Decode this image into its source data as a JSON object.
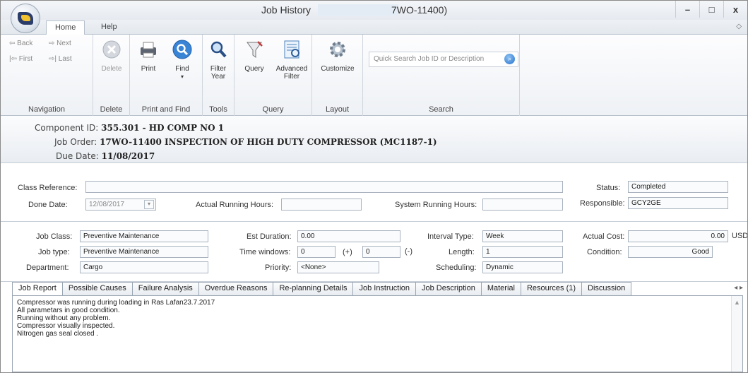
{
  "window": {
    "title": "Job History",
    "title_suffix": "7WO-11400)",
    "controls": [
      "–",
      "□",
      "x"
    ]
  },
  "ribbon_tabs": [
    "Home",
    "Help"
  ],
  "ribbon": {
    "navigation": {
      "back": "Back",
      "next": "Next",
      "first": "First",
      "last": "Last",
      "label": "Navigation"
    },
    "delete": {
      "button": "Delete",
      "label": "Delete"
    },
    "print_find": {
      "print": "Print",
      "find": "Find",
      "label": "Print and Find"
    },
    "tools": {
      "filter_year_1": "Filter",
      "filter_year_2": "Year",
      "label": "Tools"
    },
    "query": {
      "query": "Query",
      "advanced_1": "Advanced",
      "advanced_2": "Filter",
      "label": "Query"
    },
    "layout": {
      "customize": "Customize",
      "label": "Layout"
    },
    "search": {
      "placeholder": "Quick Search Job ID or Description",
      "label": "Search"
    }
  },
  "header": {
    "component_label": "Component ID:",
    "component_value": "355.301 - HD COMP NO 1",
    "job_order_label": "Job Order:",
    "job_order_value": "17WO-11400 INSPECTION OF HIGH DUTY COMPRESSOR (MC1187-1)",
    "due_date_label": "Due Date:",
    "due_date_value": "11/08/2017"
  },
  "section1": {
    "class_reference_label": "Class Reference:",
    "class_reference_value": "",
    "done_date_label": "Done Date:",
    "done_date_value": "12/08/2017",
    "actual_running_hours_label": "Actual Running Hours:",
    "actual_running_hours_value": "",
    "system_running_hours_label": "System Running Hours:",
    "system_running_hours_value": "",
    "status_label": "Status:",
    "status_value": "Completed",
    "responsible_label": "Responsible:",
    "responsible_value": "GCY2GE"
  },
  "section2": {
    "job_class_label": "Job Class:",
    "job_class_value": "Preventive Maintenance",
    "job_type_label": "Job type:",
    "job_type_value": "Preventive Maintenance",
    "department_label": "Department:",
    "department_value": "Cargo",
    "est_duration_label": "Est Duration:",
    "est_duration_value": "0.00",
    "time_windows_label": "Time windows:",
    "time_windows_plus_value": "0",
    "time_windows_plus_sign": "(+)",
    "time_windows_minus_value": "0",
    "time_windows_minus_sign": "(-)",
    "priority_label": "Priority:",
    "priority_value": "<None>",
    "interval_type_label": "Interval Type:",
    "interval_type_value": "Week",
    "length_label": "Length:",
    "length_value": "1",
    "scheduling_label": "Scheduling:",
    "scheduling_value": "Dynamic",
    "actual_cost_label": "Actual Cost:",
    "actual_cost_value": "0.00",
    "currency": "USD",
    "condition_label": "Condition:",
    "condition_value": "Good"
  },
  "bottom_tabs": [
    "Job Report",
    "Possible Causes",
    "Failure Analysis",
    "Overdue Reasons",
    "Re-planning Details",
    "Job Instruction",
    "Job Description",
    "Material",
    "Resources (1)",
    "Discussion"
  ],
  "job_report": [
    "Compressor was  running during loading in Ras Lafan23.7.2017",
    "All parametars in good condition.",
    "Running without any problem.",
    "Compressor visually inspected.",
    "Nitrogen gas seal closed ."
  ],
  "colors": {
    "accent": "#2370c9",
    "field_border": "#a9b3bf",
    "ribbon_bg": "#eef1f5"
  }
}
